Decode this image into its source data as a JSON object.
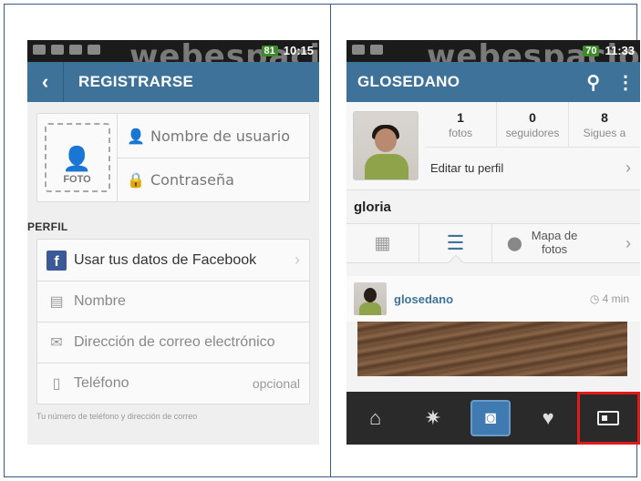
{
  "left": {
    "status": {
      "battery": "81",
      "time": "10:15"
    },
    "watermark": "webespacio",
    "header": {
      "back": "‹",
      "title": "REGISTRARSE"
    },
    "photo": {
      "label": "FOTO"
    },
    "fields": {
      "username_placeholder": "Nombre de usuario",
      "password_placeholder": "Contraseña"
    },
    "section_label": "PERFIL",
    "facebook_label": "Usar tus datos de Facebook",
    "name_placeholder": "Nombre",
    "email_placeholder": "Dirección de correo electrónico",
    "phone_placeholder": "Teléfono",
    "phone_optional": "opcional",
    "footnote": "Tu número de teléfono y dirección de correo"
  },
  "right": {
    "status": {
      "battery": "70",
      "time": "11:33"
    },
    "watermark": "webespacio",
    "header": {
      "title": "GLOSEDANO"
    },
    "stats": [
      {
        "num": "1",
        "label": "fotos"
      },
      {
        "num": "0",
        "label": "seguidores"
      },
      {
        "num": "8",
        "label": "Sigues a"
      }
    ],
    "edit_profile": "Editar tu perfil",
    "username": "gloria",
    "map_label_1": "Mapa de",
    "map_label_2": "fotos",
    "post": {
      "user": "glosedano",
      "time": "4 min"
    }
  },
  "icons": {
    "back": "chevron-left-icon",
    "search": "search-icon",
    "menu": "overflow-menu-icon",
    "home": "home-icon",
    "explore": "explore-icon",
    "camera": "camera-icon",
    "activity": "heart-bubble-icon",
    "profile": "profile-card-icon"
  },
  "colors": {
    "header_blue": "#3f7298",
    "facebook": "#3b5998",
    "highlight": "#e01a1a"
  }
}
